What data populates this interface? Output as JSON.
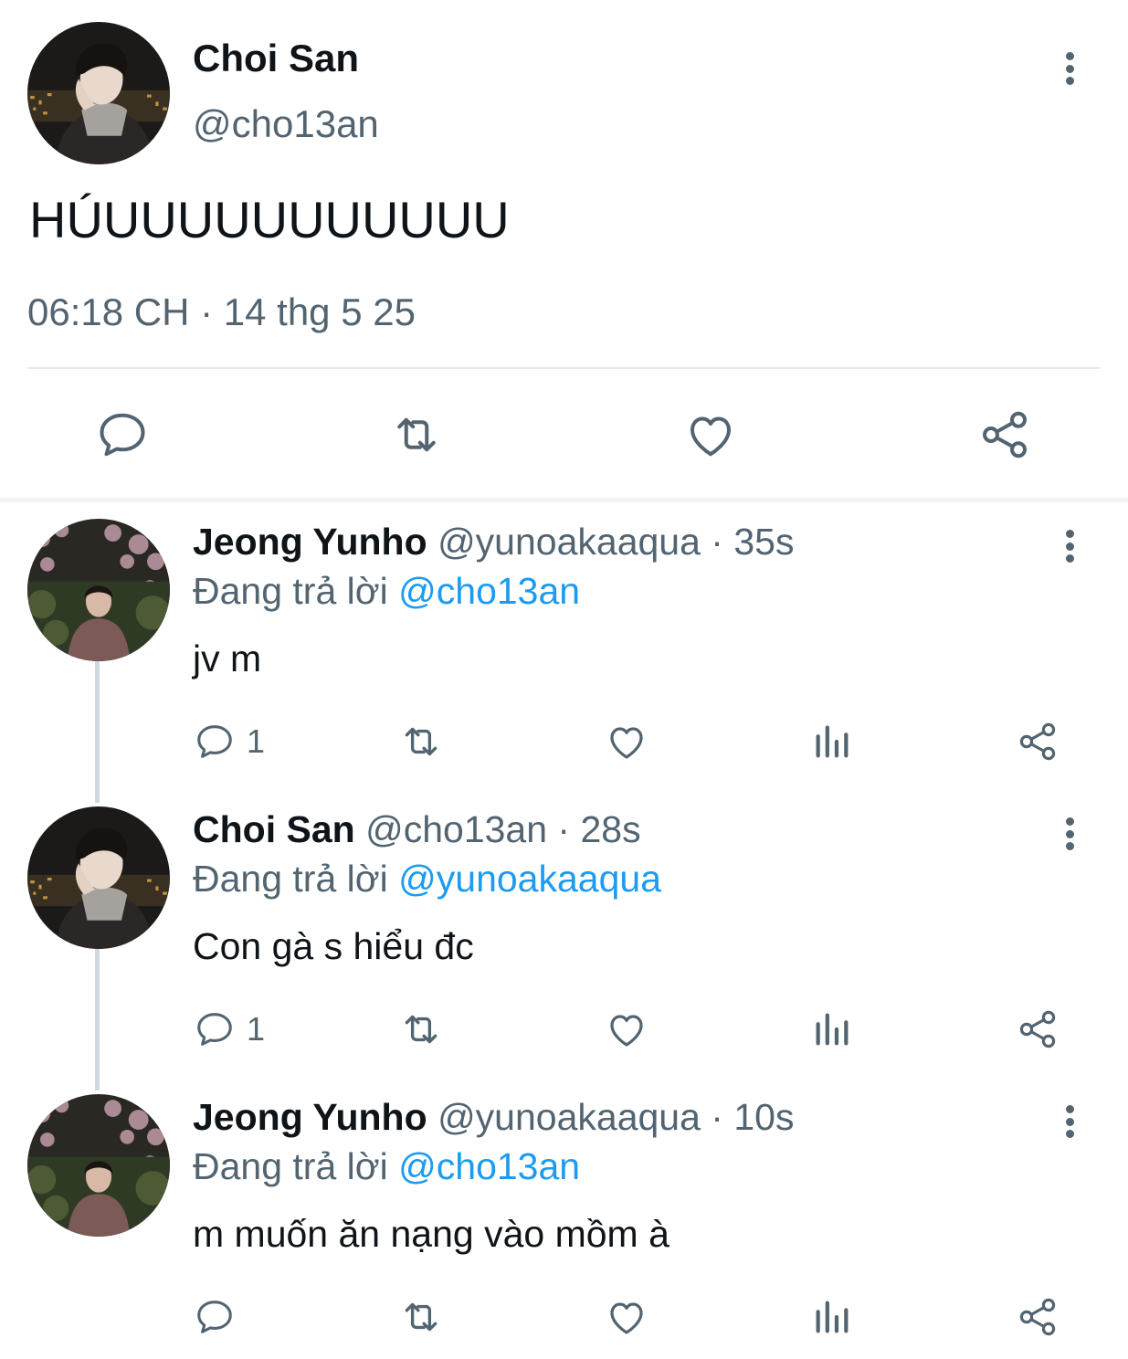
{
  "main_tweet": {
    "author_name": "Choi San",
    "author_handle": "@cho13an",
    "text": "HÚUUUUUUUUUUU",
    "timestamp": "06:18 CH · 14 thg 5 25",
    "actions": [
      "reply-icon",
      "retweet-icon",
      "like-icon",
      "share-icon"
    ]
  },
  "replies": [
    {
      "name": "Jeong Yunho",
      "handle": "@yunoakaaqua",
      "time": "35s",
      "replying_prefix": "Đang trả lời",
      "replying_to": "@cho13an",
      "text": "jv m",
      "reply_count": "1"
    },
    {
      "name": "Choi San",
      "handle": "@cho13an",
      "time": "28s",
      "replying_prefix": "Đang trả lời",
      "replying_to": "@yunoakaaqua",
      "text": "Con gà s hiểu đc",
      "reply_count": "1"
    },
    {
      "name": "Jeong Yunho",
      "handle": "@yunoakaaqua",
      "time": "10s",
      "replying_prefix": "Đang trả lời",
      "replying_to": "@cho13an",
      "text": "m muốn ăn nạng vào mồm à",
      "reply_count": ""
    }
  ],
  "colors": {
    "text_primary": "#0f1419",
    "text_secondary": "#536471",
    "accent": "#1d9bf0",
    "divider": "#e6e9eb"
  }
}
